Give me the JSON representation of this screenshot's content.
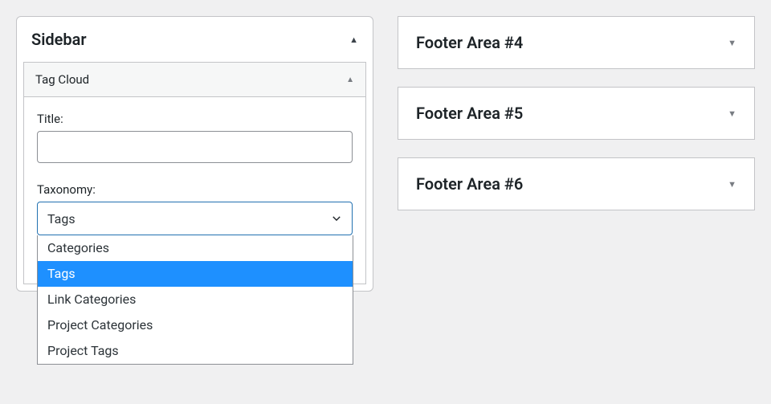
{
  "sidebar": {
    "title": "Sidebar",
    "widget": {
      "name": "Tag Cloud",
      "fields": {
        "title_label": "Title:",
        "title_value": "",
        "taxonomy_label": "Taxonomy:",
        "taxonomy_selected": "Tags",
        "taxonomy_options": [
          "Categories",
          "Tags",
          "Link Categories",
          "Project Categories",
          "Project Tags"
        ]
      }
    }
  },
  "footer_areas": [
    {
      "title": "Footer Area #4"
    },
    {
      "title": "Footer Area #5"
    },
    {
      "title": "Footer Area #6"
    }
  ]
}
